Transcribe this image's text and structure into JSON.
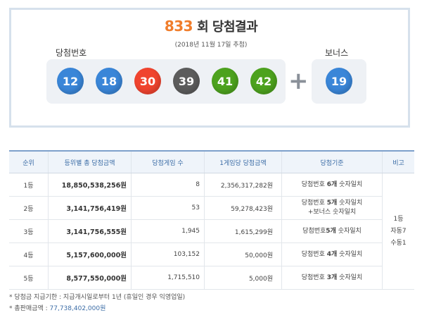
{
  "draw": {
    "round": "833",
    "title_suffix": "회 당첨결과",
    "date": "(2018년 11월 17일 추첨)"
  },
  "labels": {
    "main": "당첨번호",
    "bonus": "보너스",
    "plus": "+"
  },
  "balls": [
    {
      "n": "12",
      "color": "#3a86d8"
    },
    {
      "n": "18",
      "color": "#3a86d8"
    },
    {
      "n": "30",
      "color": "#f0442f"
    },
    {
      "n": "39",
      "color": "#5c5c5c"
    },
    {
      "n": "41",
      "color": "#4da21e"
    },
    {
      "n": "42",
      "color": "#4da21e"
    }
  ],
  "bonus_ball": {
    "n": "19",
    "color": "#3a86d8"
  },
  "table": {
    "headers": [
      "순위",
      "등위별 총 당첨금액",
      "당첨게임 수",
      "1게임당 당첨금액",
      "당첨기준",
      "비고"
    ],
    "rows": [
      {
        "rank": "1등",
        "total": "18,850,538,256원",
        "count": "8",
        "each": "2,356,317,282원",
        "crit_pre": "당첨번호 ",
        "crit_b": "6개",
        "crit_post": " 숫자일치",
        "crit2": ""
      },
      {
        "rank": "2등",
        "total": "3,141,756,419원",
        "count": "53",
        "each": "59,278,423원",
        "crit_pre": "당첨번호 ",
        "crit_b": "5개",
        "crit_post": " 숫자일치",
        "crit2": "+보너스 숫자일치"
      },
      {
        "rank": "3등",
        "total": "3,141,756,555원",
        "count": "1,945",
        "each": "1,615,299원",
        "crit_pre": "당첨번호",
        "crit_b": "5개",
        "crit_post": " 숫자일치",
        "crit2": ""
      },
      {
        "rank": "4등",
        "total": "5,157,600,000원",
        "count": "103,152",
        "each": "50,000원",
        "crit_pre": "당첨번호 ",
        "crit_b": "4개",
        "crit_post": " 숫자일치",
        "crit2": ""
      },
      {
        "rank": "5등",
        "total": "8,577,550,000원",
        "count": "1,715,510",
        "each": "5,000원",
        "crit_pre": "당첨번호 ",
        "crit_b": "3개",
        "crit_post": " 숫자일치",
        "crit2": ""
      }
    ],
    "note": [
      "1등",
      "자동7",
      "수동1"
    ]
  },
  "footer": {
    "line1": "* 당첨금 지급기한 : 지급개시일로부터 1년 (휴일인 경우 익영업일)",
    "line2_label": "* 총판매금액 : ",
    "line2_value": "77,738,402,000원"
  }
}
